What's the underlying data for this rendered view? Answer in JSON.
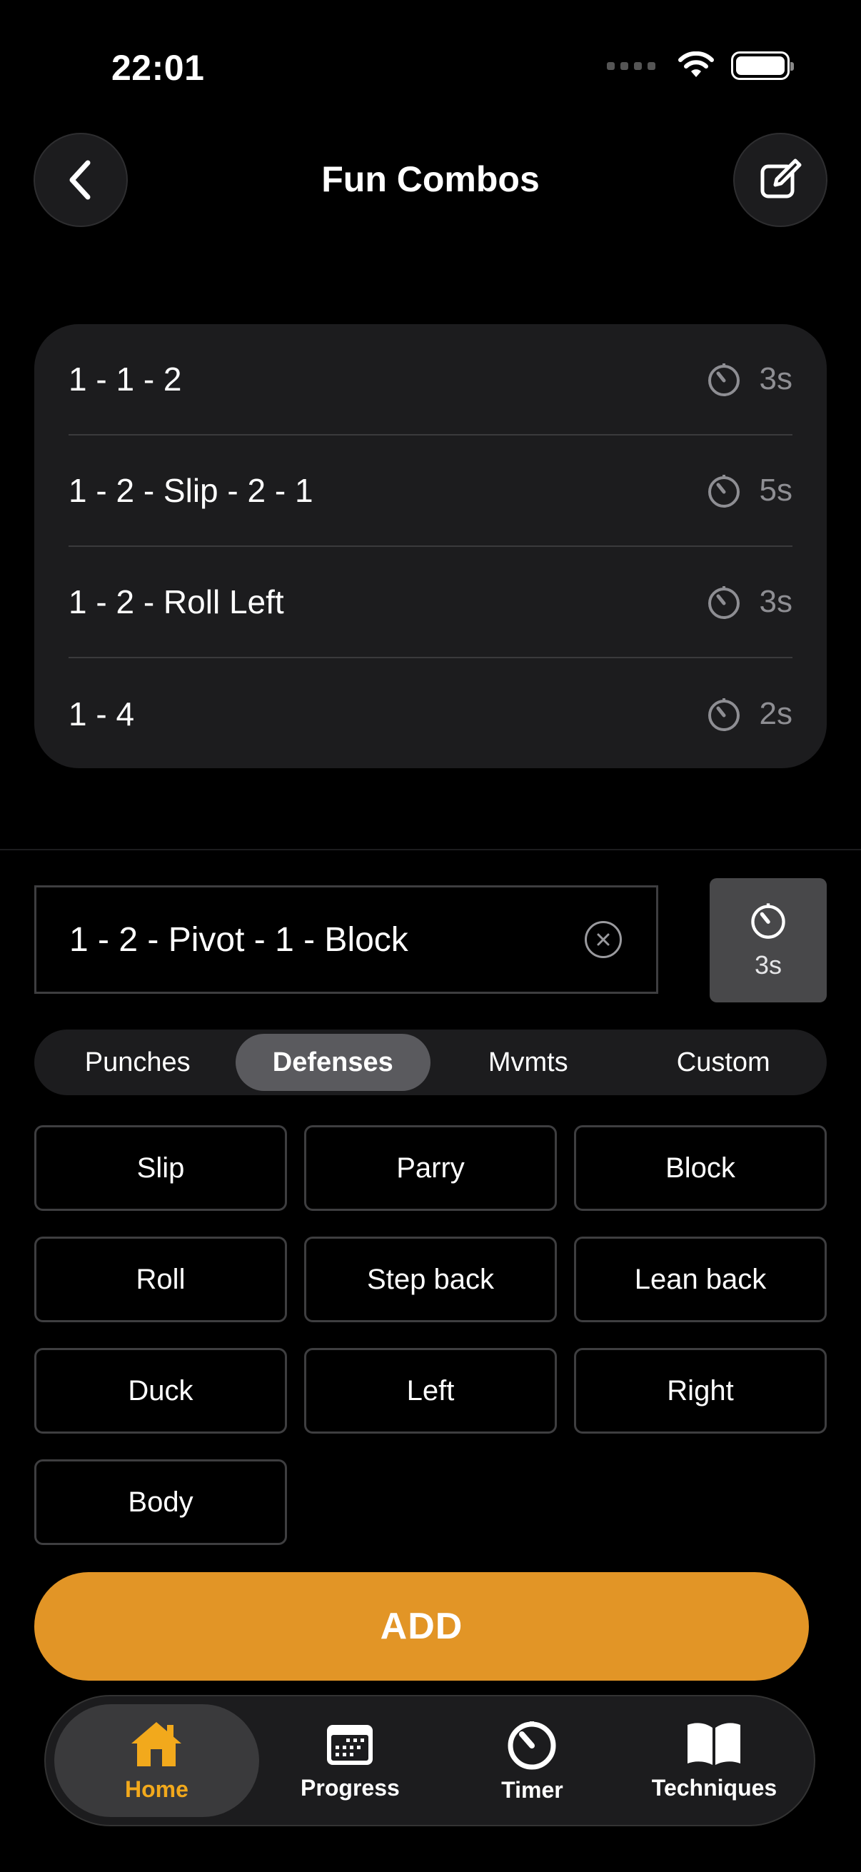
{
  "status_bar": {
    "time": "22:01"
  },
  "header": {
    "title": "Fun Combos"
  },
  "combos": [
    {
      "text": "1 - 1 - 2",
      "duration": "3s"
    },
    {
      "text": "1 - 2 - Slip - 2 - 1",
      "duration": "5s"
    },
    {
      "text": "1 - 2 - Roll Left",
      "duration": "3s"
    },
    {
      "text": "1 - 4",
      "duration": "2s"
    }
  ],
  "editor": {
    "input_value": "1 - 2 - Pivot - 1 - Block",
    "duration": "3s"
  },
  "segments": [
    "Punches",
    "Defenses",
    "Mvmts",
    "Custom"
  ],
  "selected_segment": "Defenses",
  "moves": [
    "Slip",
    "Parry",
    "Block",
    "Roll",
    "Step back",
    "Lean back",
    "Duck",
    "Left",
    "Right",
    "Body"
  ],
  "add_label": "ADD",
  "tabbar": [
    {
      "label": "Home",
      "icon": "home-icon"
    },
    {
      "label": "Progress",
      "icon": "calendar-icon"
    },
    {
      "label": "Timer",
      "icon": "timer-icon"
    },
    {
      "label": "Techniques",
      "icon": "book-icon"
    }
  ],
  "colors": {
    "accent": "#e29526",
    "active_tab": "#f2a91c"
  }
}
